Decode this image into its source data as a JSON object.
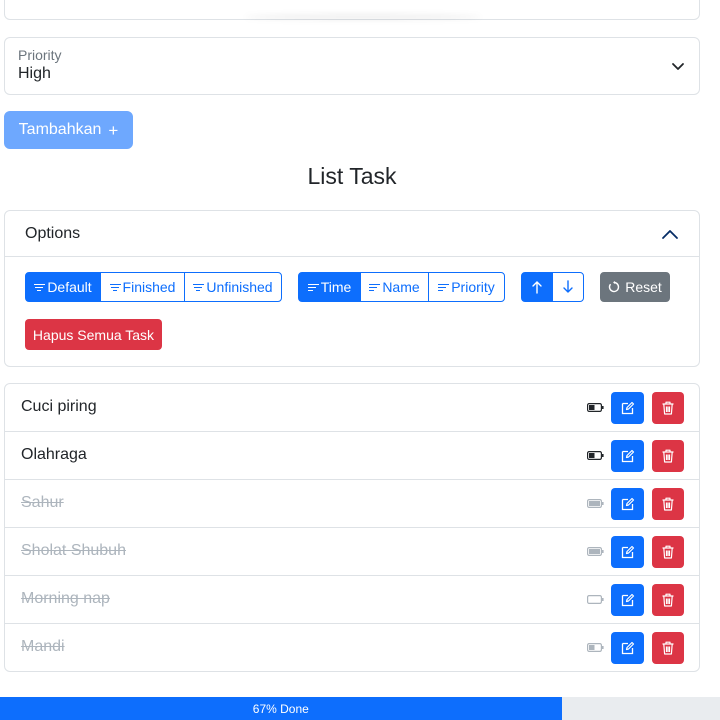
{
  "priority_select": {
    "label": "Priority",
    "value": "High"
  },
  "add_button": {
    "label": "Tambahkan",
    "icon": "plus-icon"
  },
  "list_title": "List Task",
  "options": {
    "header": "Options",
    "expanded": true,
    "filter_buttons": [
      {
        "label": "Default",
        "active": true
      },
      {
        "label": "Finished",
        "active": false
      },
      {
        "label": "Unfinished",
        "active": false
      }
    ],
    "sort_buttons": [
      {
        "label": "Time",
        "active": true
      },
      {
        "label": "Name",
        "active": false
      },
      {
        "label": "Priority",
        "active": false
      }
    ],
    "order_buttons": [
      {
        "icon": "arrow-up-icon",
        "active": true
      },
      {
        "icon": "arrow-down-icon",
        "active": false
      }
    ],
    "reset_label": "Reset",
    "delete_all_label": "Hapus Semua Task"
  },
  "tasks": [
    {
      "name": "Cuci piring",
      "done": false,
      "battery_level": 0.5
    },
    {
      "name": "Olahraga",
      "done": false,
      "battery_level": 0.5
    },
    {
      "name": "Sahur",
      "done": true,
      "battery_level": 1.0
    },
    {
      "name": "Sholat Shubuh",
      "done": true,
      "battery_level": 1.0
    },
    {
      "name": "Morning nap",
      "done": true,
      "battery_level": 0.0
    },
    {
      "name": "Mandi",
      "done": true,
      "battery_level": 0.5
    }
  ],
  "progress": {
    "label": "67% Done",
    "percent": 78
  },
  "colors": {
    "primary": "#0d6efd",
    "danger": "#dc3545",
    "secondary": "#6c757d",
    "primary_light": "#6ea8fe"
  }
}
